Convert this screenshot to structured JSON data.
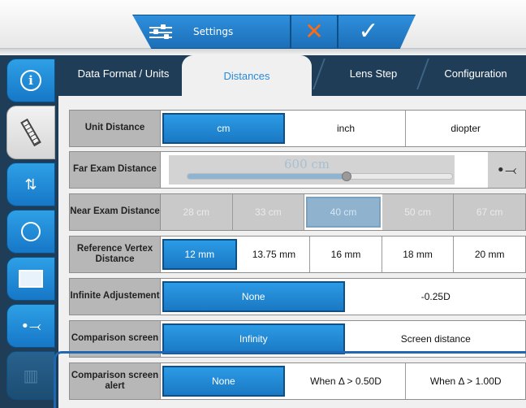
{
  "topbar": {
    "settings_label": "Settings",
    "icons": {
      "settings": "sliders-icon",
      "cancel": "close-icon",
      "confirm": "check-icon"
    }
  },
  "rail": {
    "items": [
      {
        "name": "info-icon",
        "glyph": "ⓘ"
      },
      {
        "name": "ruler-icon",
        "glyph": "📏"
      },
      {
        "name": "tray-download-icon",
        "glyph": "⤓"
      },
      {
        "name": "network-globe-icon",
        "glyph": "◎"
      },
      {
        "name": "monitor-icon",
        "glyph": "▭"
      },
      {
        "name": "usb-icon",
        "glyph": "⭠"
      },
      {
        "name": "chart-icon",
        "glyph": "▦"
      }
    ]
  },
  "tabs": [
    {
      "label": "Data Format / Units"
    },
    {
      "label": "Distances"
    },
    {
      "label": "Lens Step"
    },
    {
      "label": "Configuration"
    }
  ],
  "rows": {
    "unit_distance": {
      "label": "Unit Distance",
      "options": [
        "cm",
        "inch",
        "diopter"
      ],
      "selected": "cm"
    },
    "far_exam": {
      "label": "Far Exam Distance",
      "value": "600 cm",
      "slider_fraction": 0.6
    },
    "near_exam": {
      "label": "Near Exam Distance",
      "options": [
        "28 cm",
        "33 cm",
        "40 cm",
        "50 cm",
        "67 cm"
      ],
      "selected": "40 cm"
    },
    "reference_vertex": {
      "label": "Reference Vertex Distance",
      "options": [
        "12 mm",
        "13.75 mm",
        "16 mm",
        "18 mm",
        "20 mm"
      ],
      "selected": "12 mm"
    },
    "infinite_adjust": {
      "label": "Infinite Adjustement",
      "options": [
        "None",
        "-0.25D"
      ],
      "selected": "None"
    },
    "comparison_screen": {
      "label": "Comparison screen",
      "options": [
        "Infinity",
        "Screen distance"
      ],
      "selected": "Infinity"
    },
    "comparison_alert": {
      "label": "Comparison screen alert",
      "options": [
        "None",
        "When Δ > 0.50D",
        "When Δ > 1.00D"
      ],
      "selected": "None"
    }
  },
  "colors": {
    "accent": "#1f7ccc",
    "rail": "#1f3d57",
    "cancel": "#ff6a14"
  }
}
